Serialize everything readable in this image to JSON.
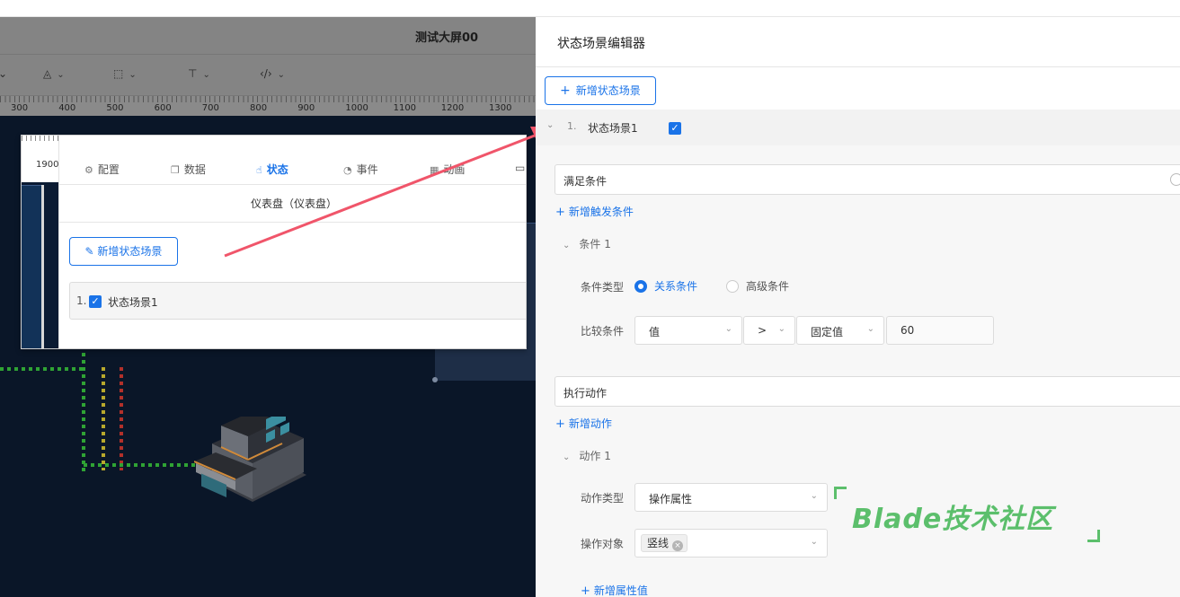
{
  "editor": {
    "screen_title": "测试大屏00",
    "ruler_ticks": [
      "300",
      "400",
      "500",
      "600",
      "700",
      "800",
      "900",
      "1000",
      "1100",
      "1200",
      "1300"
    ]
  },
  "inset": {
    "ruler_tick": "1900",
    "tabs": [
      {
        "icon": "gear-icon",
        "label": "配置"
      },
      {
        "icon": "copy-icon",
        "label": "数据"
      },
      {
        "icon": "hand-pointer-icon",
        "label": "状态"
      },
      {
        "icon": "mouse-icon",
        "label": "事件"
      },
      {
        "icon": "film-icon",
        "label": "动画"
      }
    ],
    "active_tab": "状态",
    "component_title": "仪表盘（仪表盘）",
    "add_scene_button": "新增状态场景",
    "scene": {
      "index": "1.",
      "label": "状态场景1",
      "checked": true
    }
  },
  "panel": {
    "title": "状态场景编辑器",
    "add_scene_button": "新增状态场景",
    "scene": {
      "index": "1.",
      "label": "状态场景1",
      "checked": true
    },
    "condition_section": "满足条件",
    "add_trigger": "新增触发条件",
    "condition_item": "条件 1",
    "condition_type_label": "条件类型",
    "condition_type_options": [
      "关系条件",
      "高级条件"
    ],
    "condition_type_selected": "关系条件",
    "compare_label": "比较条件",
    "compare_field": "值",
    "compare_operator": ">",
    "compare_mode": "固定值",
    "compare_value": "60",
    "action_section": "执行动作",
    "add_action": "新增动作",
    "action_item": "动作 1",
    "action_type_label": "动作类型",
    "action_type_value": "操作属性",
    "action_target_label": "操作对象",
    "action_target_tag": "竖线",
    "add_property": "新增属性值"
  },
  "watermark": "Blade技术社区",
  "colors": {
    "accent": "#1a73e8",
    "watermark": "#5cbf6c",
    "canvas": "#0a1628"
  }
}
